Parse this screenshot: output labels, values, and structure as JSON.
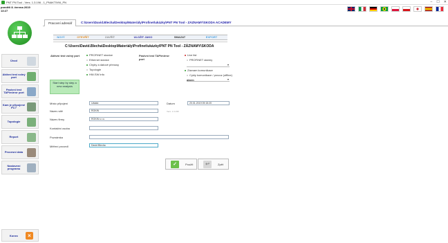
{
  "window": {
    "title": "PNT PN Tool - Vers. 1.3.196 - 1_PNAKTIVNI_PN",
    "controls": [
      "–",
      "☐",
      "✕"
    ]
  },
  "datetime": {
    "line1": "pondělí 8. června 2019",
    "line2": "13:27"
  },
  "flags": [
    "gb",
    "it",
    "de",
    "br",
    "pl",
    "cz",
    "kr",
    "es",
    "fr"
  ],
  "sidebar": {
    "items": [
      {
        "label": "Úvod",
        "icon": "home-icon",
        "color": "#d0d8e0"
      },
      {
        "label": "Aktivní test volný port",
        "icon": "active-test-icon",
        "color": "#6fae6f"
      },
      {
        "label": "Pasivní test TAP/mirror port",
        "icon": "passive-test-icon",
        "color": "#8aa8c8"
      },
      {
        "label": "Kam je připojené PC?",
        "icon": "pc-connection-icon",
        "color": "#7a9a7a"
      },
      {
        "label": "Topologie",
        "icon": "topology-icon",
        "color": "#7ab07a"
      },
      {
        "label": "Report",
        "icon": "report-icon",
        "color": "#8ab88a"
      },
      {
        "label": "Procesní data",
        "icon": "process-data-icon",
        "color": "#9a8a7a"
      },
      {
        "label": "Nastavení programu",
        "icon": "settings-icon",
        "color": "#a0b0c0"
      }
    ],
    "exit_label": "Konec"
  },
  "tab": {
    "label": "Pracovní adresář",
    "path": "C:\\Users\\David.Blecha\\Desktop\\Materiály\\Profinet\\ukázky\\PNT PN Tool - ZÁZNAMY\\SKODA ACADEMY"
  },
  "toolbar": [
    {
      "label": "NOVÝ",
      "color": "#4aa0e0"
    },
    {
      "label": "OTEVŘÍT",
      "color": "#e08a20"
    },
    {
      "label": "ZAVŘÍT",
      "color": "#888888"
    },
    {
      "label": "ULOŽIT JAKO",
      "color": "#2a2aa0"
    },
    {
      "label": "SMAZAT",
      "color": "#333333"
    },
    {
      "label": "EXPORT",
      "color": "#4aa0e0"
    }
  ],
  "project_path": "C:\\Users\\David.Blecha\\Desktop\\Materiály\\Profinet\\ukázky\\PNT PN Tool - ZÁZNAMY\\SKODA",
  "active_test": {
    "heading": "Aktivní test volný port",
    "options": [
      {
        "label": "PROFINET stanice",
        "color": "#2a9a2a"
      },
      {
        "label": "Ethernet stanice",
        "color": "#c8c8c8"
      },
      {
        "label": "Chyby a datové přenosy",
        "color": "#2a9a2a"
      },
      {
        "label": "Topologie",
        "color": "#c8c8c8"
      },
      {
        "label": "HW-SW info",
        "color": "#2a9a2a"
      }
    ]
  },
  "passive_test": {
    "heading": "Pasivní test TAP/mirror port",
    "options": [
      {
        "label": "Live list",
        "color": "#cc2222"
      },
      {
        "label": "PROFINET alarmy",
        "color": "#c8c8c8"
      },
      {
        "label": "Záznam komunikace",
        "color": "#2a9a2a"
      },
      {
        "label": "Cykly komunikace / provoz (offline)",
        "color": "#c8c8c8"
      }
    ],
    "select1": "",
    "select2": "alarm"
  },
  "start_button": "Start step by step a new analysis",
  "form": {
    "location_label": "Místo připojení",
    "location_value": "Uáááá",
    "date_label": "Datum",
    "date_value": "20.01.2019 09:15:20",
    "network_label": "Název sítě",
    "network_value": "ROKIN",
    "version_hint": "Vers. 1.3.196",
    "company_label": "Název firmy",
    "company_value": "ROKIN s.r.o.",
    "contact_label": "Kontaktní osoba",
    "contact_value": "",
    "note_label": "Poznámka",
    "note_value": "",
    "executor_label": "Měření provedl",
    "executor_value": "David Blecha"
  },
  "buttons": {
    "use": "Použít",
    "back": "Zpět"
  }
}
